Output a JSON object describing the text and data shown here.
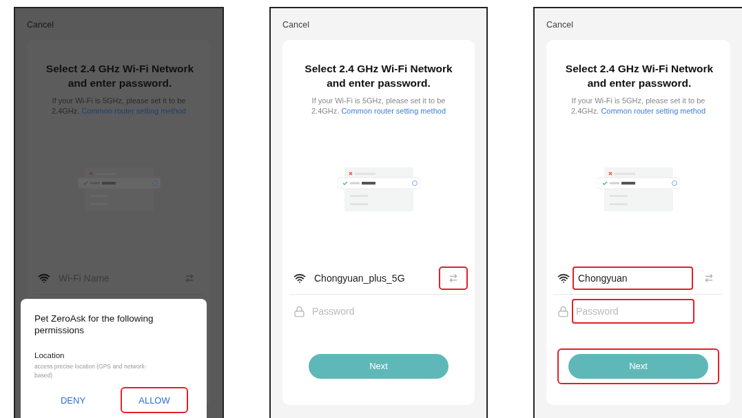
{
  "screens": [
    {
      "dimmed": true,
      "cancel": "Cancel",
      "title": "Select 2.4 GHz Wi-Fi Network and enter password.",
      "subtitle": "If your Wi-Fi is 5GHz, please set it to be 2.4GHz.",
      "link": "Common router setting method",
      "wifi_field": {
        "placeholder": "Wi-Fi Name",
        "highlighted": false
      },
      "switch_highlighted": false,
      "dialog": {
        "title": "Pet ZeroAsk for the following permissions",
        "permission": "Location",
        "description": "access precise location (GPS and network-based)",
        "buttons": [
          {
            "label": "DENY",
            "highlighted": false
          },
          {
            "label": "ALLOW",
            "highlighted": true
          }
        ]
      }
    },
    {
      "dimmed": false,
      "cancel": "Cancel",
      "title": "Select 2.4 GHz Wi-Fi Network and enter password.",
      "subtitle": "If your Wi-Fi is 5GHz, please set it to be 2.4GHz.",
      "link": "Common router setting method",
      "wifi_field": {
        "value": "Chongyuan_plus_5G",
        "highlighted": false
      },
      "switch_highlighted": true,
      "password_field": {
        "placeholder": "Password",
        "highlighted": false
      },
      "next_button": {
        "label": "Next",
        "highlighted": false
      }
    },
    {
      "dimmed": false,
      "cancel": "Cancel",
      "title": "Select 2.4 GHz Wi-Fi Network and enter password.",
      "subtitle": "If your Wi-Fi is 5GHz, please set it to be 2.4GHz.",
      "link": "Common router setting method",
      "wifi_field": {
        "value": "Chongyuan",
        "highlighted": true
      },
      "switch_highlighted": false,
      "password_field": {
        "placeholder": "Password",
        "highlighted": true
      },
      "next_button": {
        "label": "Next",
        "highlighted": true
      }
    }
  ]
}
